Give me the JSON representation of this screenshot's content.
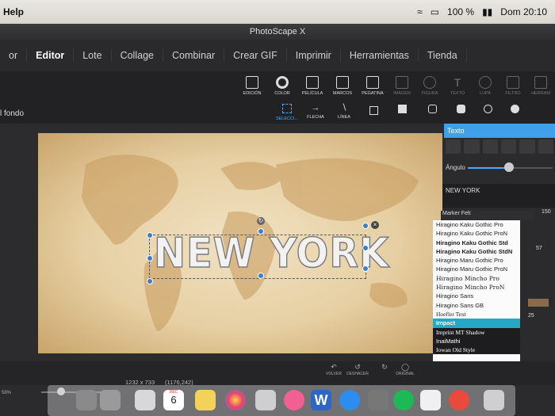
{
  "menubar": {
    "app_menu": "Help",
    "battery": "100 %",
    "clock": "Dom 20:10"
  },
  "window": {
    "title": "PhotoScape X"
  },
  "nav": {
    "tabs": [
      "or",
      "Editor",
      "Lote",
      "Collage",
      "Combinar",
      "Crear GIF",
      "Imprimir",
      "Herramientas",
      "Tienda"
    ]
  },
  "tools": [
    "EDICIÓN",
    "COLOR",
    "PELÍCULA",
    "MARCOS",
    "PEGATINA",
    "IMAGEN",
    "FIGURA",
    "TEXTO",
    "LUPA",
    "FILTRO",
    "HERRAM"
  ],
  "subtools": {
    "select": "SELECCI...",
    "arrow": "FLECHA",
    "line": "LÍNEA"
  },
  "canvas": {
    "bg_label": "l fondo",
    "text": "NEW YORK"
  },
  "panel": {
    "title": "Texto",
    "angle_label": "Ángulo",
    "text_value": "NEW YORK",
    "font_field": "Marker Felt",
    "font_size": "150",
    "fonts": [
      "Hiragino Kaku Gothic Pro",
      "Hiragino Kaku Gothic ProN",
      "Hiragino Kaku Gothic Std",
      "Hiragino Kaku Gothic StdN",
      "Hiragino Maru Gothic Pro",
      "Hiragino Maru Gothic ProN",
      "Hiragino Mincho Pro",
      "Hiragino Mincho ProN",
      "Hiragino Sans",
      "Hiragino Sans GB",
      "Hoefler Text",
      "Impact",
      "Imprint MT Shadow",
      "InaiMathi",
      "Iowan Old Style"
    ],
    "selected_font": "Impact",
    "side_values": [
      "57",
      "25"
    ]
  },
  "bottom": {
    "dimensions": "1232 x 733",
    "position": "(1176,242)",
    "zoom": "58%",
    "btn_volver": "VOLVER",
    "btn_deshacer": "DESHACER",
    "btn_original": "ORIGINAL"
  },
  "dock": {
    "calendar_month": "DEC",
    "calendar_day": "6"
  },
  "colors": {
    "accent": "#3f9fe8",
    "selected_font_bg": "#26a7c6"
  }
}
